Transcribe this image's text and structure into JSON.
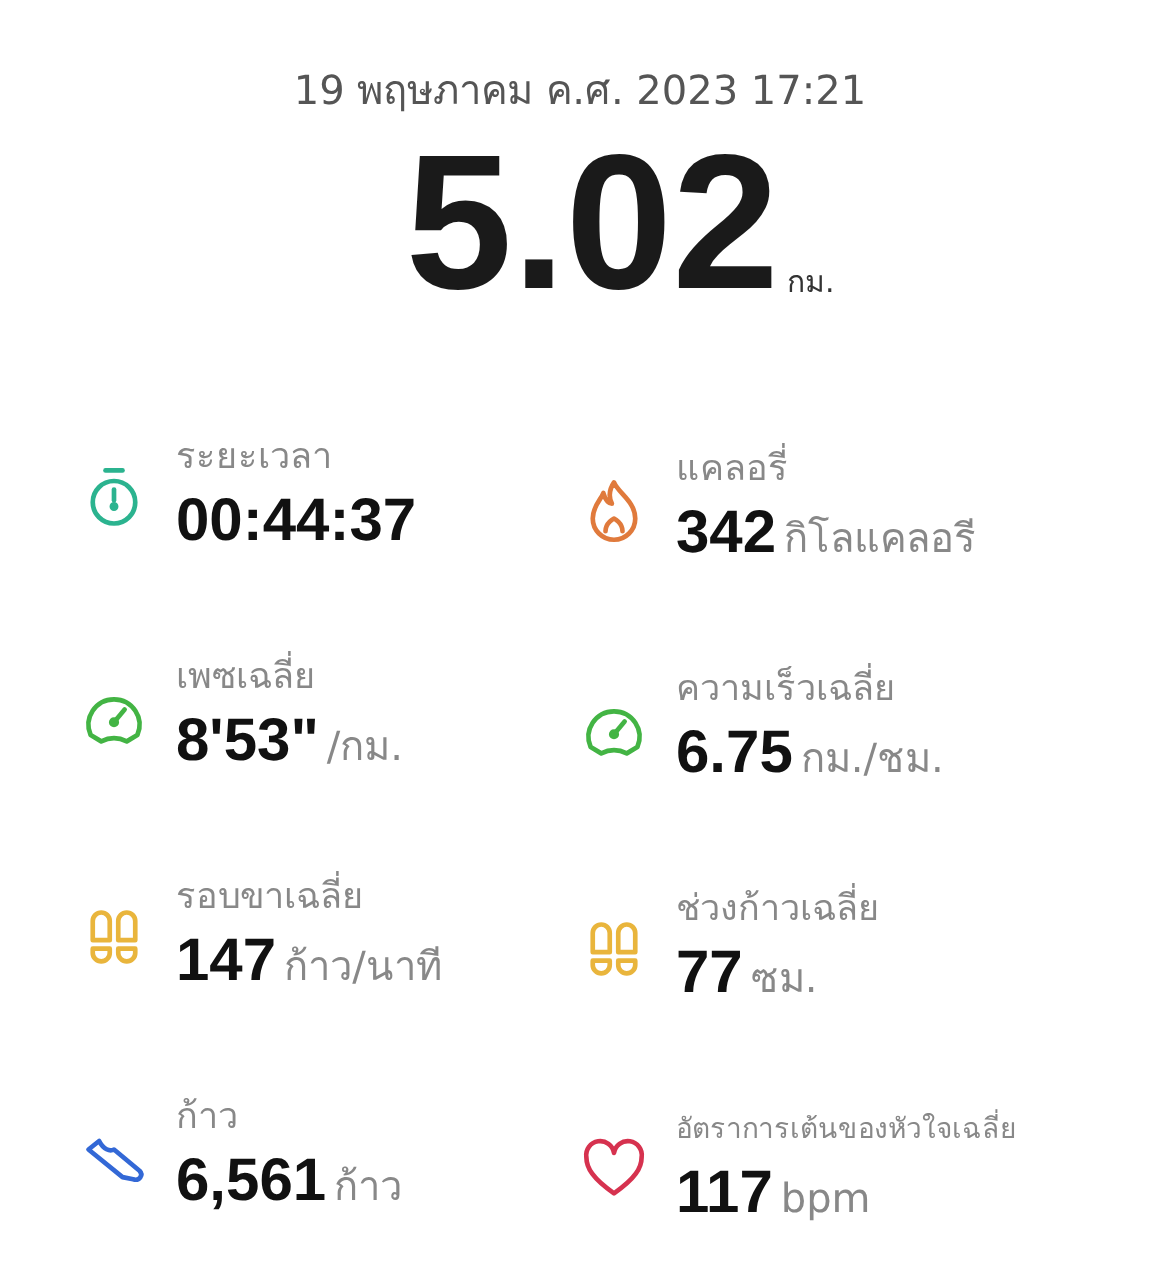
{
  "header": {
    "datetime": "19 พฤษภาคม ค.ศ. 2023 17:21",
    "distance": "5.02",
    "distance_unit": "กม."
  },
  "stats": [
    {
      "kind": "timer",
      "color": "#2bb38f",
      "label": "ระยะเวลา",
      "value": "00:44:37"
    },
    {
      "kind": "flame",
      "color": "#e07a3c",
      "label": "แคลอรี่",
      "value": "342",
      "unit": "กิโลแคลอรี"
    },
    {
      "kind": "pace",
      "color": "#43b444",
      "label": "เพซเฉลี่ย",
      "value": "8'53\"",
      "unit": "/กม."
    },
    {
      "kind": "speed",
      "color": "#43b444",
      "label": "ความเร็วเฉลี่ย",
      "value": "6.75",
      "unit": "กม./ชม."
    },
    {
      "kind": "steps",
      "color": "#e9b53c",
      "label": "รอบขาเฉลี่ย",
      "value": "147",
      "unit": "ก้าว/นาที"
    },
    {
      "kind": "steps",
      "color": "#e9b53c",
      "label": "ช่วงก้าวเฉลี่ย",
      "value": "77",
      "unit": "ซม."
    },
    {
      "kind": "shoe",
      "color": "#3368d6",
      "label": "ก้าว",
      "value": "6,561",
      "unit": "ก้าว"
    },
    {
      "kind": "heart",
      "color": "#d6324f",
      "label": "อัตราการเต้นของหัวใจเฉลี่ย",
      "value": "117",
      "unit": "bpm"
    }
  ]
}
